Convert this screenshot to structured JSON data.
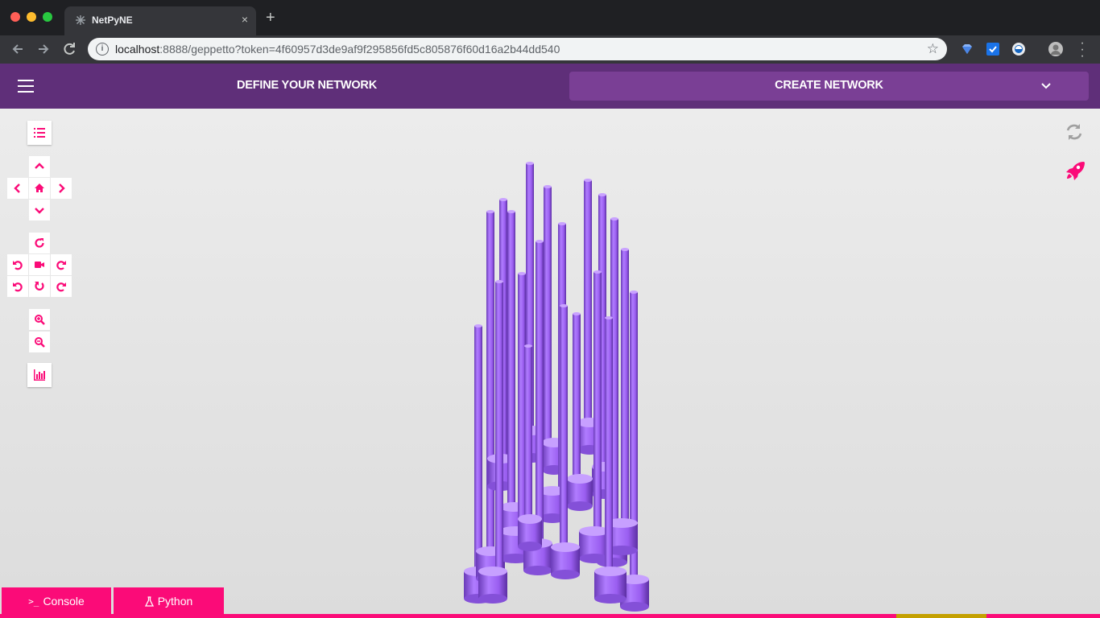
{
  "browser": {
    "tab_title": "NetPyNE",
    "new_tab": "+",
    "close": "×",
    "url_host": "localhost",
    "url_rest": ":8888/geppetto?token=4f60957d3de9af9f295856fd5c805876f60d16a2b44dd540"
  },
  "header": {
    "define_label": "DEFINE YOUR NETWORK",
    "create_label": "CREATE NETWORK"
  },
  "controls": {
    "icons": [
      "list-icon",
      "pan-up-icon",
      "pan-left-icon",
      "home-icon",
      "pan-right-icon",
      "pan-down-icon",
      "rotate-reset-icon",
      "rotate-left-icon",
      "camera-icon",
      "rotate-right-icon",
      "rotate-ccw-icon",
      "rotate-down-icon",
      "rotate-cw-icon",
      "zoom-in-icon",
      "zoom-out-icon",
      "chart-icon",
      "refresh-icon",
      "rocket-icon"
    ]
  },
  "bottom_tabs": {
    "console_label": "Console",
    "python_label": "Python"
  },
  "colors": {
    "accent": "#fb0b78",
    "header": "#5f2f79",
    "cell": "#a66df0"
  }
}
